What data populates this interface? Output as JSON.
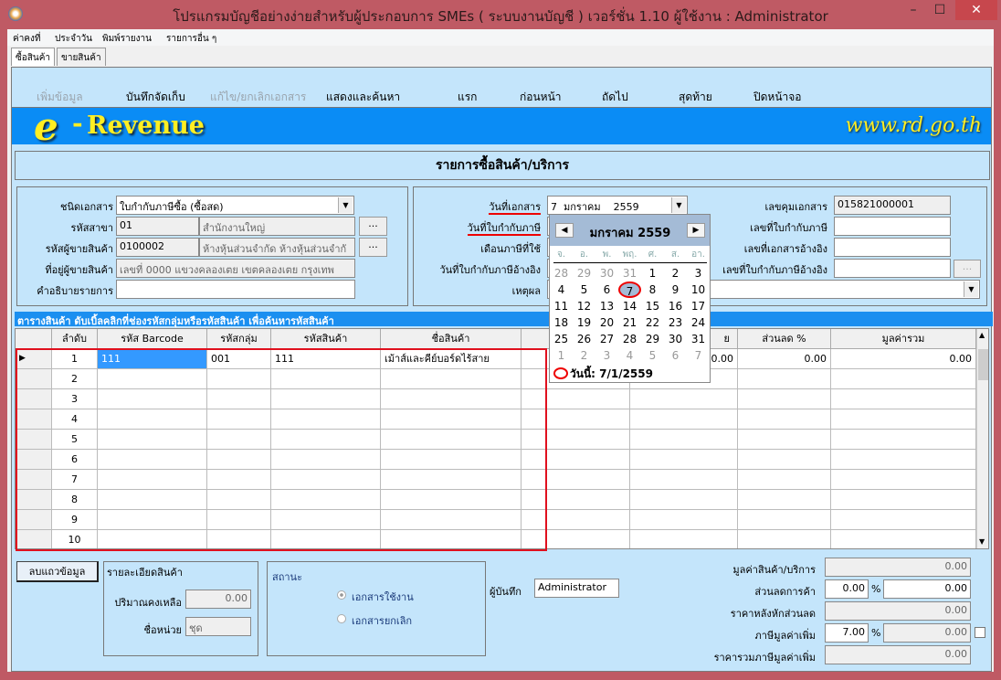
{
  "window": {
    "title": "โปรแกรมบัญชีอย่างง่ายสำหรับผู้ประกอบการ SMEs ( ระบบงานบัญชี )  เวอร์ชั่น 1.10      ผู้ใช้งาน : Administrator",
    "minimize": "–",
    "maximize": "☐",
    "close": "✕"
  },
  "menu": [
    "ค่าคงที่",
    "ประจำวัน",
    "พิมพ์รายงาน",
    "รายการอื่น ๆ"
  ],
  "tabs": [
    "ซื้อสินค้า",
    "ขายสินค้า"
  ],
  "toolbar": {
    "add": "เพิ่มข้อมูล",
    "save": "บันทึกจัดเก็บ",
    "edit": "แก้ไข/ยกเลิกเอกสาร",
    "search": "แสดงและค้นหา",
    "first": "แรก",
    "prev": "ก่อนหน้า",
    "next": "ถัดไป",
    "last": "สุดท้าย",
    "close": "ปิดหน้าจอ"
  },
  "banner": {
    "logo_e": "e",
    "logo_dash": "-",
    "logo_text": "Revenue",
    "site": "www.rd.go.th"
  },
  "heading": "รายการซื้อสินค้า/บริการ",
  "left": {
    "doc_type_label": "ชนิดเอกสาร",
    "doc_type": "ใบกำกับภาษีซื้อ (ซื้อสด)",
    "branch_label": "รหัสสาขา",
    "branch_code": "01",
    "branch_name": "สำนักงานใหญ่",
    "vendor_label": "รหัสผู้ขายสินค้า",
    "vendor_code": "0100002",
    "vendor_name": "ห้างหุ้นส่วนจำกัด ห้างหุ้นส่วนจำกั",
    "address_label": "ที่อยู่ผู้ขายสินค้า",
    "address": "เลขที่ 0000 แขวงคลองเตย เขตคลองเตย กรุงเทพ",
    "desc_label": "คำอธิบายรายการ",
    "desc": "",
    "browse": "..."
  },
  "right": {
    "doc_date_label": "วันที่เอกสาร",
    "doc_date_day": "7",
    "doc_date_month": "มกราคม",
    "doc_date_year": "2559",
    "tax_date_label": "วันที่ใบกำกับภาษี",
    "tax_month_label": "เดือนภาษีที่ใช้",
    "ref_tax_date_label": "วันที่ใบกำกับภาษีอ้างอิง",
    "reason_label": "เหตุผล",
    "control_no_label": "เลขคุมเอกสาร",
    "control_no": "015821000001",
    "tax_no_label": "เลขที่ใบกำกับภาษี",
    "ref_doc_label": "เลขที่เอกสารอ้างอิง",
    "ref_tax_no_label": "เลขที่ใบกำกับภาษีอ้างอิง",
    "browse": "..."
  },
  "calendar": {
    "title": "มกราคม 2559",
    "prev": "◀",
    "next": "▶",
    "dow": [
      "จ.",
      "อ.",
      "พ.",
      "พฤ.",
      "ศ.",
      "ส.",
      "อา."
    ],
    "weeks": [
      [
        "28",
        "29",
        "30",
        "31",
        "1",
        "2",
        "3"
      ],
      [
        "4",
        "5",
        "6",
        "7",
        "8",
        "9",
        "10"
      ],
      [
        "11",
        "12",
        "13",
        "14",
        "15",
        "16",
        "17"
      ],
      [
        "18",
        "19",
        "20",
        "21",
        "22",
        "23",
        "24"
      ],
      [
        "25",
        "26",
        "27",
        "28",
        "29",
        "30",
        "31"
      ],
      [
        "1",
        "2",
        "3",
        "4",
        "5",
        "6",
        "7"
      ]
    ],
    "today": "วันนี้: 7/1/2559"
  },
  "grid": {
    "caption": "ตารางสินค้า    ดับเบิ้ลคลิกที่ช่องรหัสกลุ่มหรือรหัสสินค้า เพื่อค้นหารหัสสินค้า",
    "headers": [
      "ลำดับ",
      "รหัส Barcode",
      "รหัสกลุ่ม",
      "รหัสสินค้า",
      "ชื่อสินค้า",
      "",
      "ย",
      "ส่วนลด %",
      "มูลค่ารวม"
    ],
    "rows": [
      [
        "1",
        "111",
        "001",
        "111",
        "เม้าส์และคีย์บอร์ดไร้สาย",
        "",
        "0.00",
        "0.00",
        "0.00"
      ],
      [
        "2",
        "",
        "",
        "",
        "",
        "",
        "",
        "",
        ""
      ],
      [
        "3",
        "",
        "",
        "",
        "",
        "",
        "",
        "",
        ""
      ],
      [
        "4",
        "",
        "",
        "",
        "",
        "",
        "",
        "",
        ""
      ],
      [
        "5",
        "",
        "",
        "",
        "",
        "",
        "",
        "",
        ""
      ],
      [
        "6",
        "",
        "",
        "",
        "",
        "",
        "",
        "",
        ""
      ],
      [
        "7",
        "",
        "",
        "",
        "",
        "",
        "",
        "",
        ""
      ],
      [
        "8",
        "",
        "",
        "",
        "",
        "",
        "",
        "",
        ""
      ],
      [
        "9",
        "",
        "",
        "",
        "",
        "",
        "",
        "",
        ""
      ],
      [
        "10",
        "",
        "",
        "",
        "",
        "",
        "",
        "",
        ""
      ]
    ]
  },
  "bottom": {
    "delete_row": "ลบแถวข้อมูล",
    "detail_title": "รายละเอียดสินค้า",
    "qty_label": "ปริมาณคงเหลือ",
    "qty": "0.00",
    "unit_label": "ชื่อหน่วย",
    "unit": "ชุด",
    "status_title": "สถานะ",
    "status_active": "เอกสารใช้งาน",
    "status_cancel": "เอกสารยกเลิก",
    "recorder_label": "ผู้บันทึก",
    "recorder": "Administrator",
    "goods_value_label": "มูลค่าสินค้า/บริการ",
    "goods_value": "0.00",
    "discount_label": "ส่วนลดการค้า",
    "discount_pct": "0.00",
    "discount_value": "0.00",
    "pct": "%",
    "after_discount_label": "ราคาหลังหักส่วนลด",
    "after_discount": "0.00",
    "vat_label": "ภาษีมูลค่าเพิ่ม",
    "vat_pct": "7.00",
    "vat_value": "0.00",
    "total_label": "ราคารวมภาษีมูลค่าเพิ่ม",
    "total": "0.00"
  }
}
